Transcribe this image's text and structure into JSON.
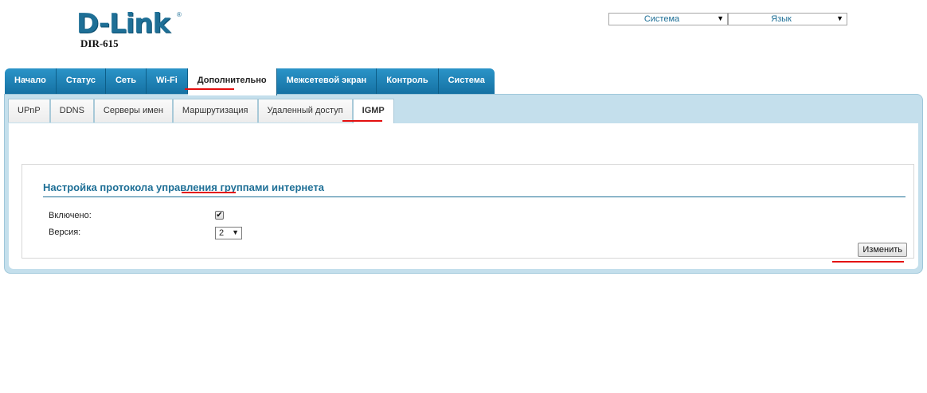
{
  "header": {
    "logo_text": "D-Link",
    "logo_reg": "®",
    "model": "DIR-615",
    "system_select": "Система",
    "language_select": "Язык"
  },
  "main_tabs": [
    {
      "label": "Начало",
      "active": false
    },
    {
      "label": "Статус",
      "active": false
    },
    {
      "label": "Сеть",
      "active": false
    },
    {
      "label": "Wi-Fi",
      "active": false
    },
    {
      "label": "Дополнительно",
      "active": true
    },
    {
      "label": "Межсетевой экран",
      "active": false
    },
    {
      "label": "Контроль",
      "active": false
    },
    {
      "label": "Система",
      "active": false
    }
  ],
  "sub_tabs": [
    {
      "label": "UPnP",
      "active": false
    },
    {
      "label": "DDNS",
      "active": false
    },
    {
      "label": "Серверы имен",
      "active": false
    },
    {
      "label": "Маршрутизация",
      "active": false
    },
    {
      "label": "Удаленный доступ",
      "active": false
    },
    {
      "label": "IGMP",
      "active": true
    }
  ],
  "igmp": {
    "title": "Настройка протокола управления группами интернета",
    "enabled_label": "Включено:",
    "enabled": true,
    "version_label": "Версия:",
    "version_value": "2"
  },
  "actions": {
    "apply_label": "Изменить"
  },
  "colors": {
    "accent": "#1e6f96",
    "tab_bar": "#1c7fb1",
    "highlight": "#e30f0f"
  },
  "icons": {
    "dropdown": "chevron-down-icon",
    "check": "checkmark-icon"
  }
}
